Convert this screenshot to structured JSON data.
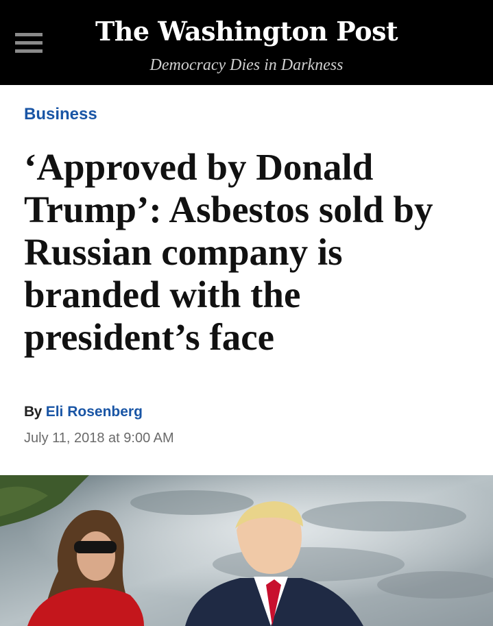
{
  "header": {
    "masthead": "The Washington Post",
    "tagline": "Democracy Dies in Darkness",
    "menu_icon": "hamburger-menu-icon",
    "background": "#000000"
  },
  "article": {
    "section": "Business",
    "headline": "‘Approved by Donald Trump’: Asbestos sold by Russian company is branded with the president’s face",
    "byline_prefix": "By",
    "author": "Eli Rosenberg",
    "timestamp": "July 11, 2018 at 9:00 AM"
  },
  "colors": {
    "link_blue": "#1955a5",
    "headline": "#111111",
    "timestamp_gray": "#6a6a6a"
  }
}
